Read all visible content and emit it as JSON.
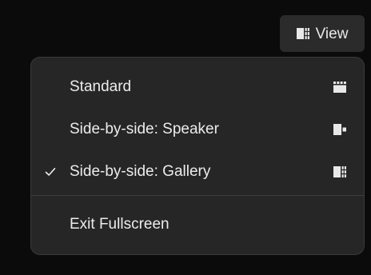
{
  "toolbar": {
    "view_label": "View",
    "view_icon": "side-by-side-gallery-icon"
  },
  "menu": {
    "items": [
      {
        "label": "Standard",
        "icon": "grid-icon",
        "checked": false
      },
      {
        "label": "Side-by-side: Speaker",
        "icon": "side-by-side-speaker-icon",
        "checked": false
      },
      {
        "label": "Side-by-side: Gallery",
        "icon": "side-by-side-gallery-icon",
        "checked": true
      },
      {
        "label": "Exit Fullscreen",
        "icon": "",
        "checked": false
      }
    ],
    "check_glyph": "✓"
  },
  "colors": {
    "background": "#0b0b0b",
    "menu_bg": "#262626",
    "text": "#ececec",
    "button_bg": "#2b2b2b"
  }
}
